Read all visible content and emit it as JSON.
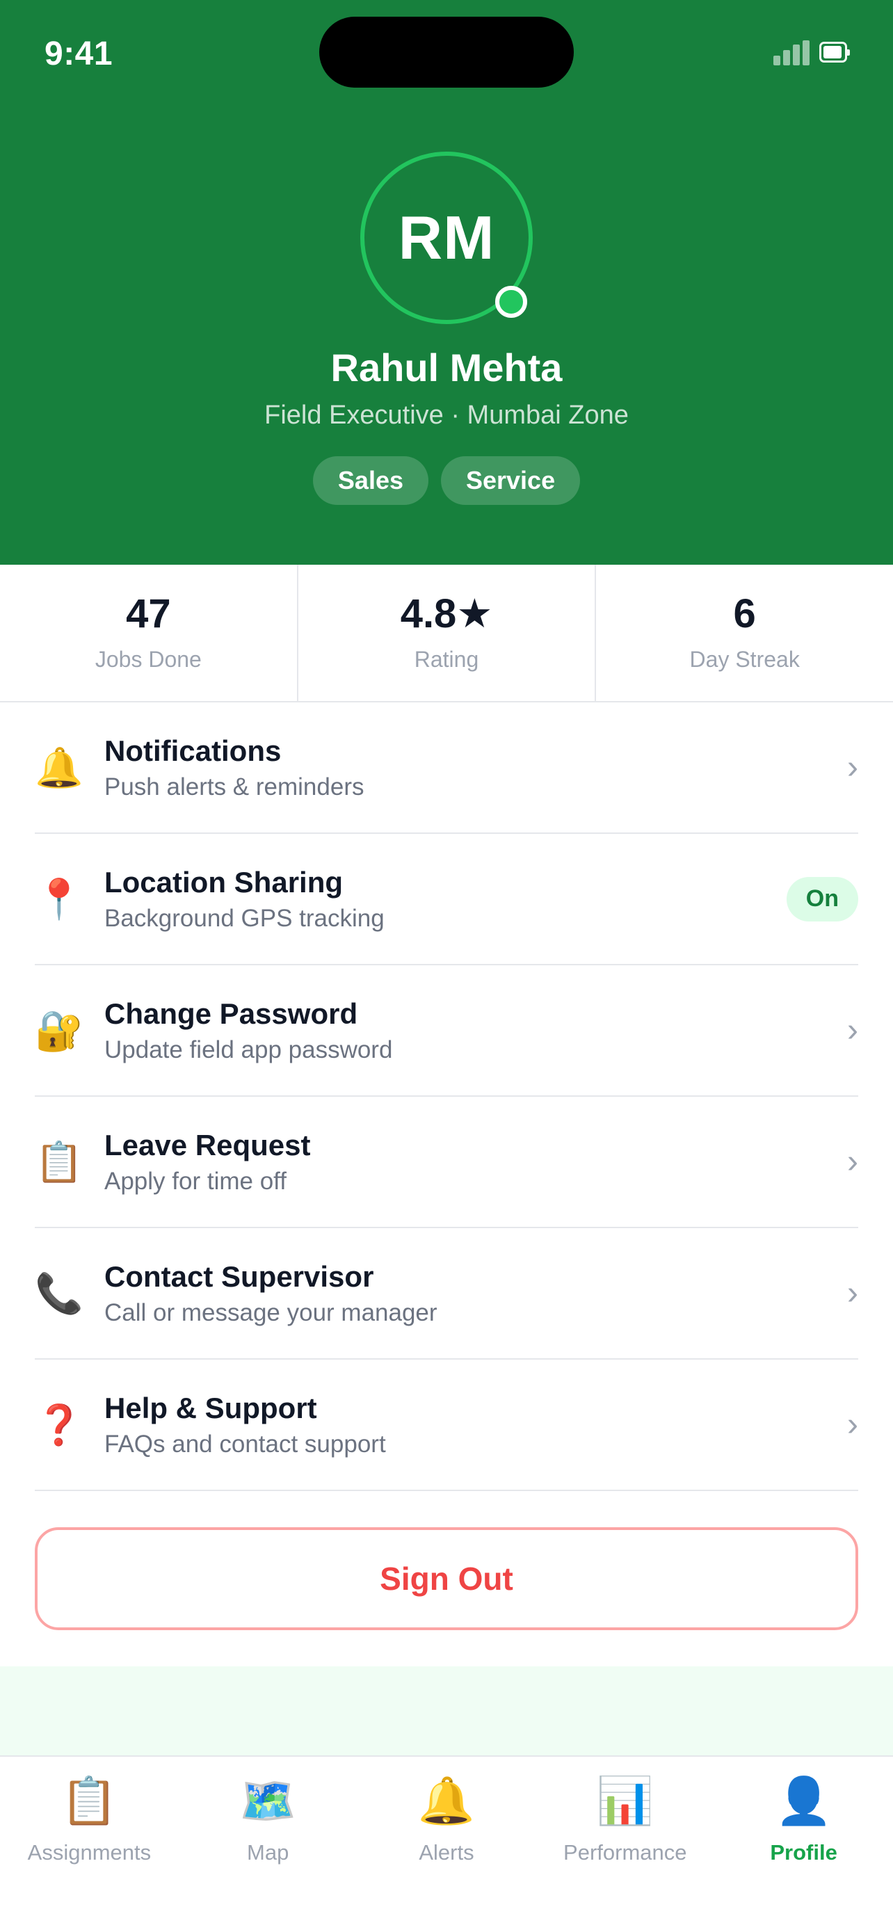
{
  "status_bar": {
    "time": "9:41"
  },
  "profile": {
    "initials": "RM",
    "name": "Rahul Mehta",
    "role": "Field Executive · Mumbai Zone",
    "tags": [
      "Sales",
      "Service"
    ]
  },
  "stats": [
    {
      "value": "47",
      "label": "Jobs Done"
    },
    {
      "value": "4.8★",
      "label": "Rating"
    },
    {
      "value": "6",
      "label": "Day Streak"
    }
  ],
  "menu": [
    {
      "icon": "🔔",
      "icon_name": "bell-icon",
      "title": "Notifications",
      "subtitle": "Push alerts & reminders",
      "chevron": "›"
    },
    {
      "icon": "📍",
      "icon_name": "location-pin-icon",
      "title": "Location Sharing",
      "subtitle": "Background GPS tracking",
      "badge": "On"
    },
    {
      "icon": "🔐",
      "icon_name": "lock-icon",
      "title": "Change Password",
      "subtitle": "Update field app password",
      "chevron": "›"
    },
    {
      "icon": "📋",
      "icon_name": "clipboard-icon",
      "title": "Leave Request",
      "subtitle": "Apply for time off",
      "chevron": "›"
    },
    {
      "icon": "📞",
      "icon_name": "phone-icon",
      "title": "Contact Supervisor",
      "subtitle": "Call or message your manager",
      "chevron": "›"
    },
    {
      "icon": "❓",
      "icon_name": "help-icon",
      "title": "Help & Support",
      "subtitle": "FAQs and contact support",
      "chevron": "›"
    }
  ],
  "sign_out_label": "Sign Out",
  "tabs": [
    {
      "icon": "📋",
      "label": "Assignments"
    },
    {
      "icon": "🗺️",
      "label": "Map"
    },
    {
      "icon": "🔔",
      "label": "Alerts"
    },
    {
      "icon": "📊",
      "label": "Performance"
    },
    {
      "icon": "👤",
      "label": "Profile",
      "active": true
    }
  ],
  "colors": {
    "header_green": "#17803d",
    "accent_green": "#22c55e",
    "active_tab": "#16a34a",
    "danger": "#ef4444"
  }
}
